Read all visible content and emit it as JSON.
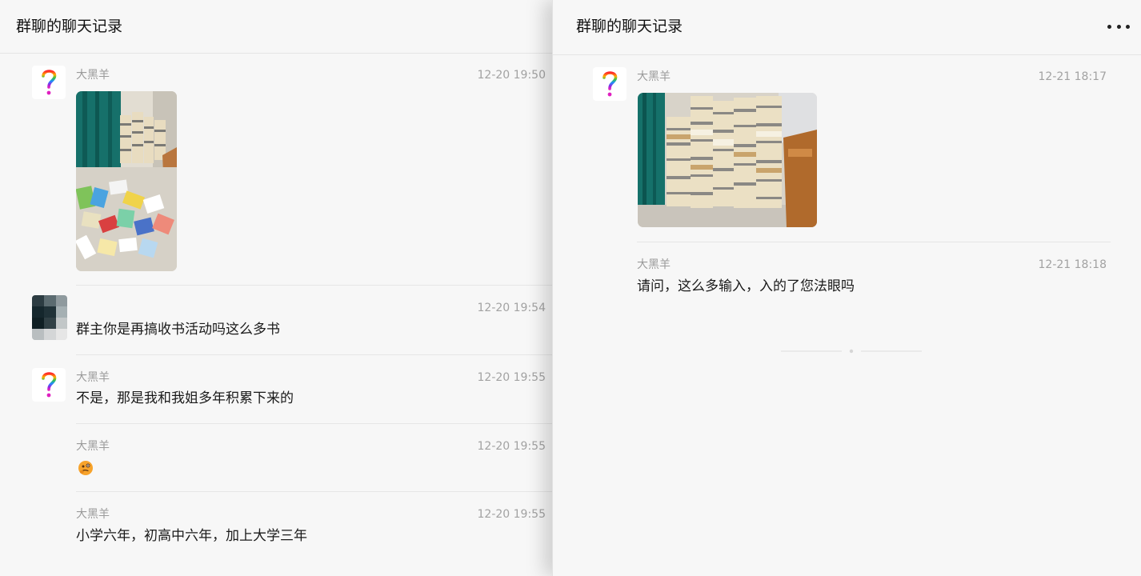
{
  "colors": {
    "pane_background": "#f7f7f7",
    "divider": "#e6e6e6",
    "meta_text": "#9a9a9a",
    "message_text": "#1a1a1a"
  },
  "left_pane": {
    "title": "群聊的聊天记录",
    "messages": [
      {
        "sender": "大黑羊",
        "time": "12-20 19:50",
        "content_type": "image",
        "avatar": "rainbow-question-mark"
      },
      {
        "sender": "",
        "time": "12-20 19:54",
        "text": "群主你是再搞收书活动吗这么多书",
        "avatar": "pixelated-avatar"
      },
      {
        "sender": "大黑羊",
        "time": "12-20 19:55",
        "text": "不是，那是我和我姐多年积累下来的",
        "avatar": "rainbow-question-mark"
      },
      {
        "sender": "大黑羊",
        "time": "12-20 19:55",
        "content_type": "emoji",
        "emoji": "thinking-face-icon"
      },
      {
        "sender": "大黑羊",
        "time": "12-20 19:55",
        "text": "小学六年，初高中六年，加上大学三年"
      }
    ]
  },
  "right_pane": {
    "title": "群聊的聊天记录",
    "more_icon": "more-dots-icon",
    "messages": [
      {
        "sender": "大黑羊",
        "time": "12-21 18:17",
        "content_type": "image",
        "avatar": "rainbow-question-mark"
      },
      {
        "sender": "大黑羊",
        "time": "12-21 18:18",
        "text": "请问，这么多输入，入的了您法眼吗"
      }
    ]
  }
}
